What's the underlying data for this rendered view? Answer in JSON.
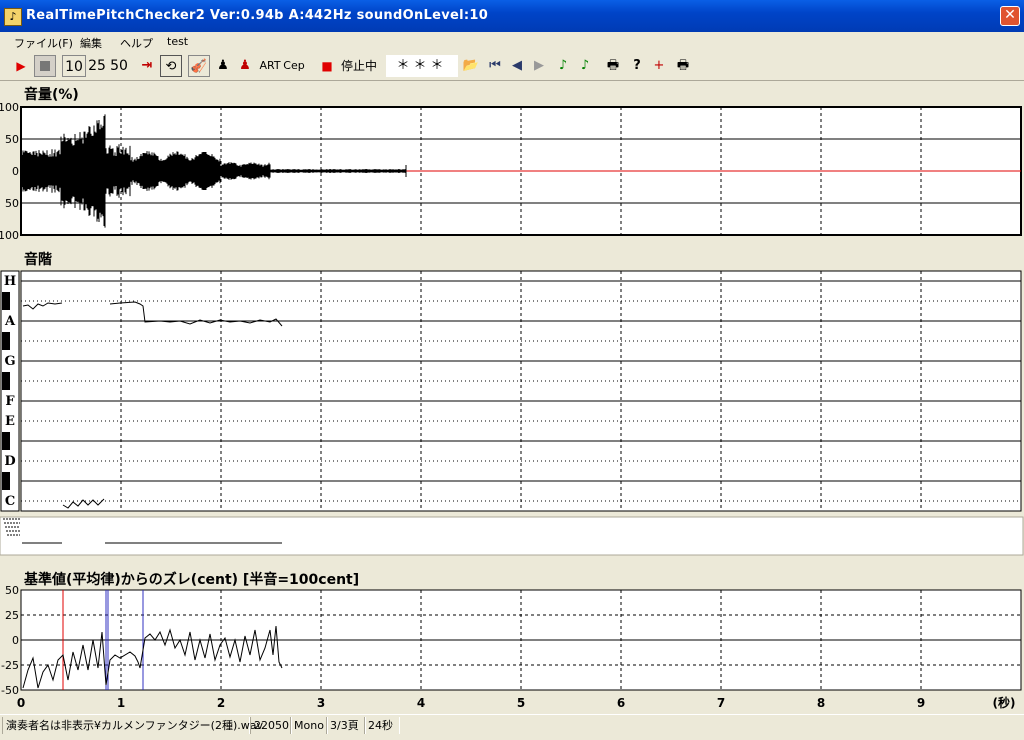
{
  "window": {
    "title": "RealTimePitchChecker2   Ver:0.94b        A:442Hz    soundOnLevel:10",
    "close_symbol": "✕"
  },
  "menu": [
    {
      "label": "ファイル(F)"
    },
    {
      "label": "編集"
    },
    {
      "label": "ヘルプ"
    },
    {
      "label": "test"
    }
  ],
  "toolbar": {
    "speed_10": "10",
    "speed_25": "25",
    "speed_50": "50",
    "art_label": "ART",
    "cep_label": "Cep",
    "status_label": "停止中",
    "display_value": "＊＊＊"
  },
  "volume_panel": {
    "title": "音量(%)",
    "y_labels": [
      "100",
      "50",
      "0",
      "50",
      "100"
    ]
  },
  "scale_panel": {
    "title": "音階",
    "notes": [
      "H",
      "A",
      "G",
      "F",
      "E",
      "D",
      "C"
    ]
  },
  "deviation_panel": {
    "title": "基準値(平均律)からのズレ(cent) [半音=100cent]",
    "y_labels": [
      "50",
      "25",
      "0",
      "-25",
      "-50"
    ]
  },
  "time_axis": {
    "ticks": [
      "0",
      "1",
      "2",
      "3",
      "4",
      "5",
      "6",
      "7",
      "8",
      "9"
    ],
    "unit": "(秒)"
  },
  "statusbar": {
    "file": "演奏者名は非表示¥カルメンファンタジー(2種).wav",
    "rate": "22050",
    "channels": "Mono",
    "page": "3/3頁",
    "duration": "24秒"
  },
  "colors": {
    "accent_red": "#e00000",
    "marker_blue": "#3030c0",
    "grid": "#000000"
  }
}
